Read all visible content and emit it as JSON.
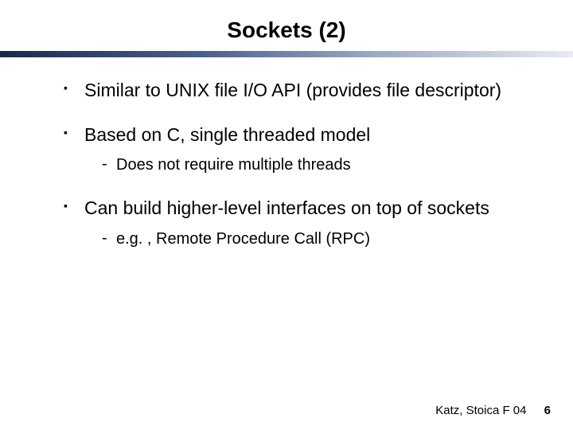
{
  "title": "Sockets (2)",
  "bullets": [
    {
      "text": "Similar to UNIX file I/O API (provides file descriptor)",
      "sub": []
    },
    {
      "text": "Based on C, single threaded model",
      "sub": [
        "Does not require multiple threads"
      ]
    },
    {
      "text": "Can build higher-level interfaces on top of sockets",
      "sub": [
        "e.g. , Remote Procedure Call (RPC)"
      ]
    }
  ],
  "footer": {
    "credit": "Katz, Stoica F 04",
    "page": "6"
  }
}
